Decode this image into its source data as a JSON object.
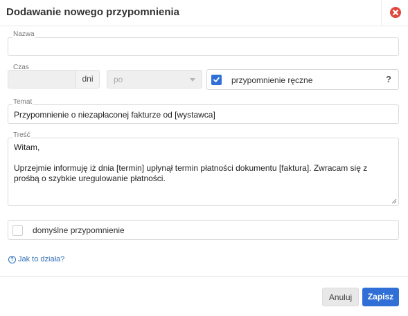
{
  "dialog": {
    "title": "Dodawanie nowego przypomnienia",
    "close_icon": "close-circle-icon"
  },
  "form": {
    "name": {
      "label": "Nazwa",
      "value": ""
    },
    "time": {
      "label": "Czas",
      "value": "",
      "unit": "dni",
      "select_value": "po",
      "manual_checkbox_label": "przypomnienie ręczne",
      "manual_checked": true,
      "help_mark": "?"
    },
    "subject": {
      "label": "Temat",
      "value": "Przypomnienie o niezapłaconej fakturze od [wystawca]"
    },
    "body": {
      "label": "Treść",
      "value": "Witam,\n\nUprzejmie informuję iż dnia [termin] upłynął termin płatności dokumentu [faktura]. Zwracam się z prośbą o szybkie uregulowanie płatności."
    },
    "default_checkbox_label": "domyślne przypomnienie",
    "default_checked": false,
    "help_link": "Jak to działa?"
  },
  "footer": {
    "cancel_label": "Anuluj",
    "save_label": "Zapisz"
  },
  "colors": {
    "accent": "#2f6fd6",
    "close": "#e0483e",
    "link": "#2f6fb8"
  }
}
